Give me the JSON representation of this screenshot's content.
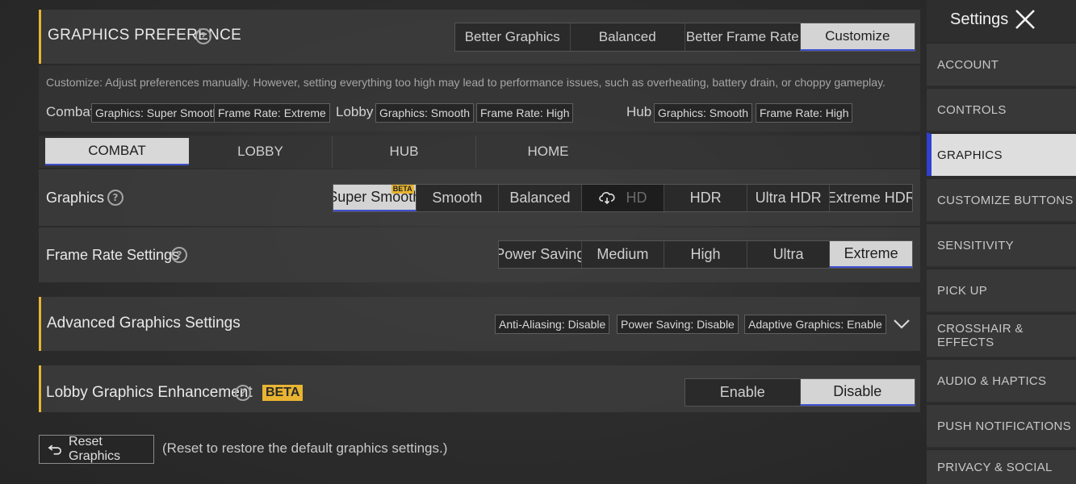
{
  "graphics_preference": {
    "title": "GRAPHICS PREFERENCE",
    "options": [
      "Better Graphics",
      "Balanced",
      "Better Frame Rate",
      "Customize"
    ],
    "selected": "Customize",
    "description": "Customize: Adjust preferences manually. However, setting everything too high may lead to performance issues, such as overheating, battery drain, or choppy gameplay.",
    "summary": {
      "combat_label": "Combat",
      "combat_graphics": "Graphics: Super Smooth",
      "combat_frame": "Frame Rate: Extreme",
      "lobby_label": "Lobby",
      "lobby_graphics": "Graphics: Smooth",
      "lobby_frame": "Frame Rate: High",
      "hub_label": "Hub",
      "hub_graphics": "Graphics: Smooth",
      "hub_frame": "Frame Rate: High"
    }
  },
  "mode_tabs": [
    "COMBAT",
    "LOBBY",
    "HUB",
    "HOME"
  ],
  "mode_selected": "COMBAT",
  "graphics": {
    "label": "Graphics",
    "options": [
      "Super Smooth",
      "Smooth",
      "Balanced",
      "HD",
      "HDR",
      "Ultra HDR",
      "Extreme HDR"
    ],
    "selected": "Super Smooth",
    "beta_badge": "BETA",
    "download_option": "HD"
  },
  "frame_rate": {
    "label": "Frame Rate Settings",
    "options": [
      "Power Saving",
      "Medium",
      "High",
      "Ultra",
      "Extreme"
    ],
    "selected": "Extreme"
  },
  "advanced": {
    "title": "Advanced Graphics Settings",
    "chips": [
      "Anti-Aliasing: Disable",
      "Power Saving: Disable",
      "Adaptive Graphics: Enable"
    ]
  },
  "lobby_enhancement": {
    "title": "Lobby Graphics Enhancement",
    "beta": "BETA",
    "options": [
      "Enable",
      "Disable"
    ],
    "selected": "Disable"
  },
  "reset": {
    "label": "Reset Graphics",
    "note": "(Reset to restore the default graphics settings.)"
  },
  "sidebar": {
    "title": "Settings",
    "items": [
      "ACCOUNT",
      "CONTROLS",
      "GRAPHICS",
      "CUSTOMIZE BUTTONS",
      "SENSITIVITY",
      "PICK UP",
      "CROSSHAIR & EFFECTS",
      "AUDIO & HAPTICS",
      "PUSH NOTIFICATIONS",
      "PRIVACY & SOCIAL"
    ],
    "selected": "GRAPHICS"
  },
  "colors": {
    "accent": "#e8b431",
    "selection_underline": "#3f4fd0",
    "sidebar_selected_bar": "#3040d0"
  }
}
